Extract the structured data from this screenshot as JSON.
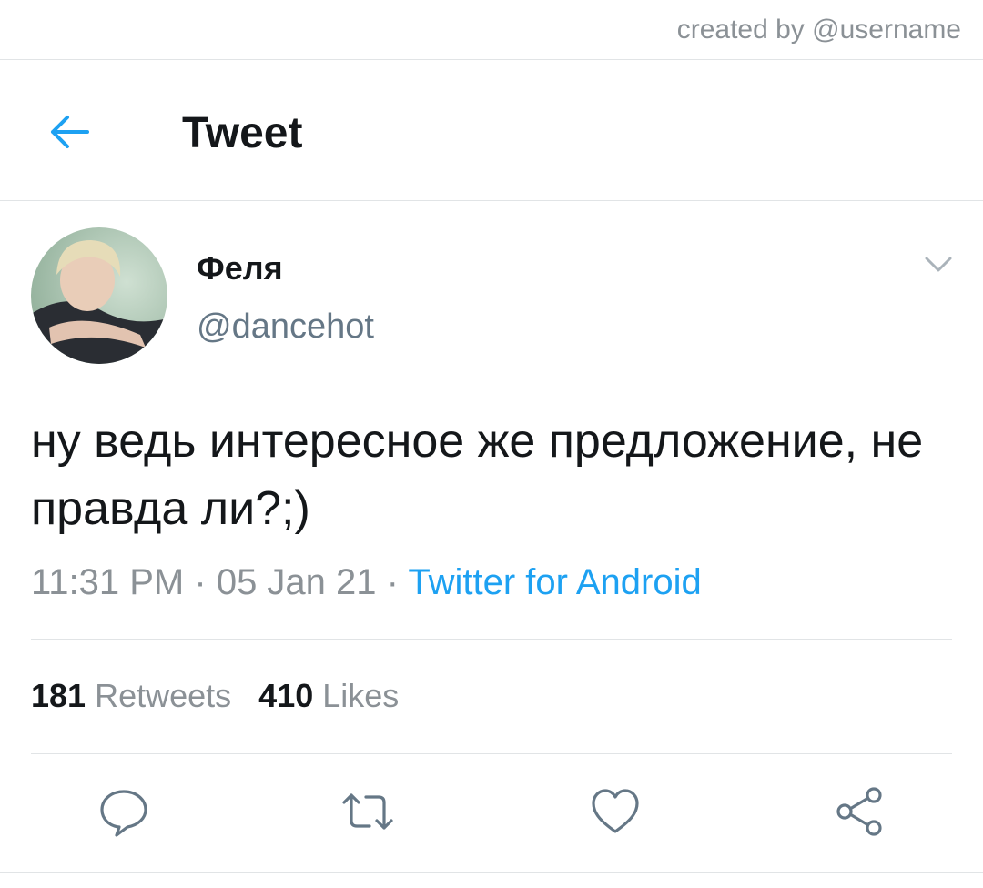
{
  "watermark": "created by @username",
  "header": {
    "back_icon": "arrow-left-icon",
    "title": "Tweet"
  },
  "tweet": {
    "author": {
      "display_name": "Феля",
      "handle": "@dancehot"
    },
    "text": "ну ведь интересное же предложение, не правда ли?;)",
    "time": "11:31 PM",
    "separator": "·",
    "date": "05 Jan 21",
    "source": "Twitter for Android",
    "retweets": {
      "count": "181",
      "label": "Retweets"
    },
    "likes": {
      "count": "410",
      "label": "Likes"
    }
  },
  "actions": [
    {
      "name": "reply",
      "icon": "speech-bubble-icon"
    },
    {
      "name": "retweet",
      "icon": "retweet-icon"
    },
    {
      "name": "like",
      "icon": "heart-icon"
    },
    {
      "name": "share",
      "icon": "share-icon"
    }
  ],
  "colors": {
    "accent": "#1da1f2",
    "text_primary": "#14171a",
    "text_secondary": "#8b9196",
    "divider": "#e1e4e6"
  }
}
